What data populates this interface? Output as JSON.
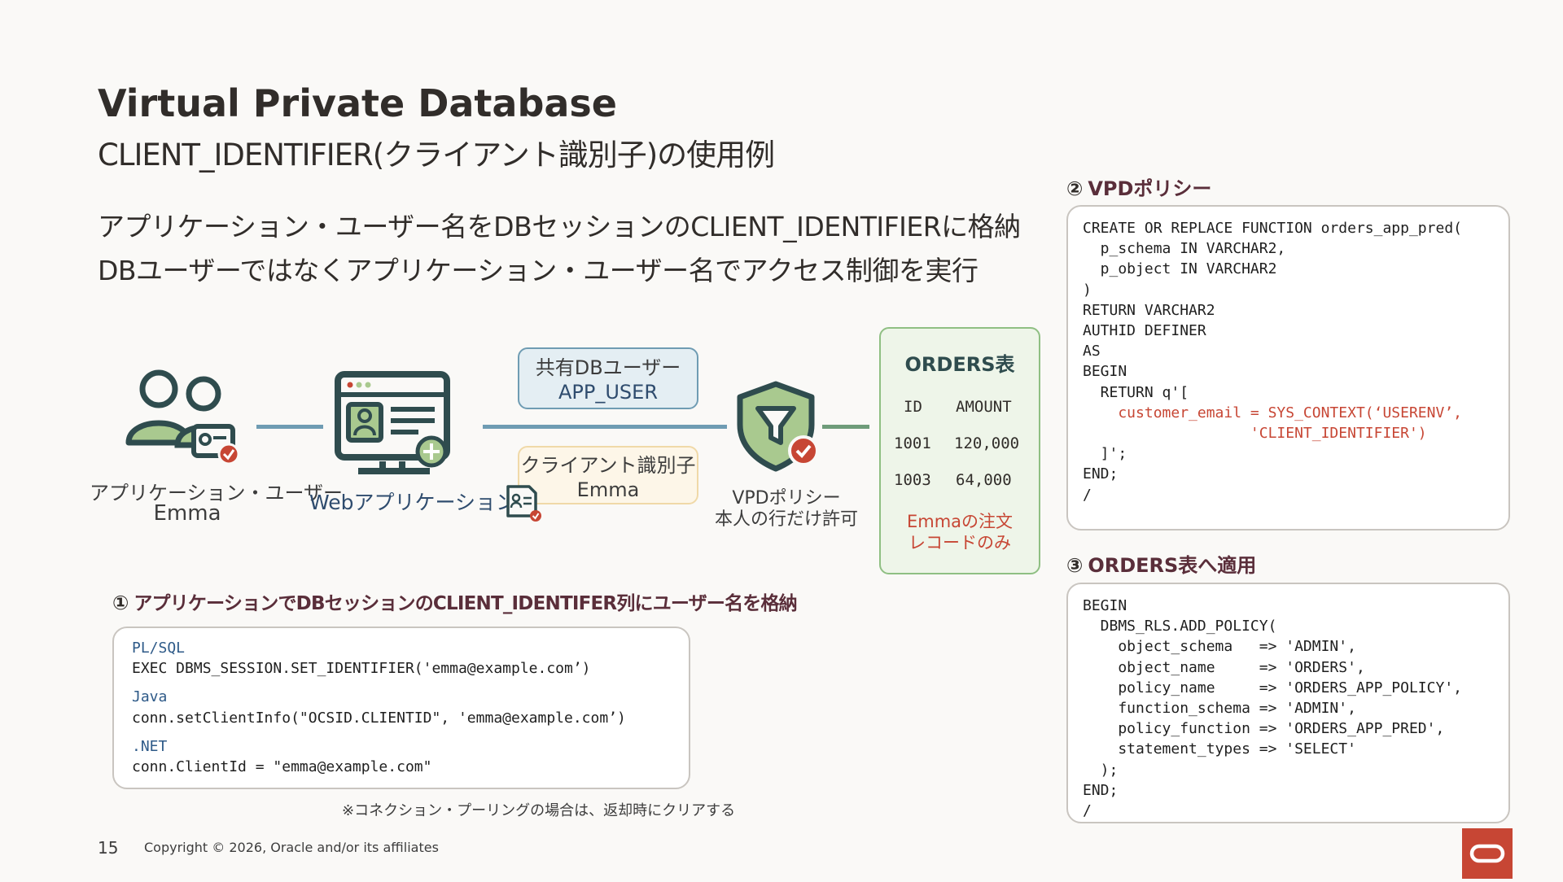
{
  "header": {
    "title": "Virtual Private Database",
    "subtitle": "CLIENT_IDENTIFIER(クライアント識別子)の使用例"
  },
  "bullets": [
    "アプリケーション・ユーザー名をDBセッションのCLIENT_IDENTIFIERに格納",
    "DBユーザーではなくアプリケーション・ユーザー名でアクセス制御を実行"
  ],
  "diagram": {
    "app_user": {
      "line1": "アプリケーション・ユーザー",
      "line2": "Emma"
    },
    "web_app": {
      "label": "Webアプリケーション"
    },
    "shared_db_user": {
      "line1": "共有DBユーザー",
      "line2": "APP_USER"
    },
    "client_identifier": {
      "line1": "クライアント識別子",
      "line2": "Emma"
    },
    "vpd_policy": {
      "line1": "VPDポリシー",
      "line2": "本人の行だけ許可"
    },
    "orders_table": {
      "title": "ORDERS表",
      "columns": [
        "ID",
        "AMOUNT"
      ],
      "rows": [
        [
          "1001",
          "120,000"
        ],
        [
          "1003",
          "64,000"
        ]
      ],
      "note_line1": "Emmaの注文",
      "note_line2": "レコードのみ"
    }
  },
  "section1": {
    "number": "①",
    "title": "アプリケーションでDBセッションのCLIENT_IDENTIFER列にユーザー名を格納",
    "plsql_label": "PL/SQL",
    "plsql_code": "EXEC DBMS_SESSION.SET_IDENTIFIER('emma@example.com’)",
    "java_label": "Java",
    "java_code": "conn.setClientInfo(\"OCSID.CLIENTID\", 'emma@example.com’)",
    "net_label": ".NET",
    "net_code": "conn.ClientId = \"emma@example.com\"",
    "note": "※コネクション・プーリングの場合は、返却時にクリアする"
  },
  "section2": {
    "number": "②",
    "title": "VPDポリシー",
    "code_before": "CREATE OR REPLACE FUNCTION orders_app_pred(\n  p_schema IN VARCHAR2,\n  p_object IN VARCHAR2\n)\nRETURN VARCHAR2\nAUTHID DEFINER\nAS\nBEGIN\n  RETURN q'[",
    "code_highlight": "    customer_email = SYS_CONTEXT(‘USERENV’,\n                   'CLIENT_IDENTIFIER')",
    "code_after": "  ]';\nEND;\n/"
  },
  "section3": {
    "number": "③",
    "title": "ORDERS表へ適用",
    "code": "BEGIN\n  DBMS_RLS.ADD_POLICY(\n    object_schema   => 'ADMIN',\n    object_name     => 'ORDERS',\n    policy_name     => 'ORDERS_APP_POLICY',\n    function_schema => 'ADMIN',\n    policy_function => 'ORDERS_APP_PRED',\n    statement_types => 'SELECT'\n  );\nEND;\n/"
  },
  "footer": {
    "page_number": "15",
    "copyright": "Copyright © 2026, Oracle and/or its affiliates"
  },
  "colors": {
    "oracle_red": "#c74634",
    "teal_dark": "#2f4c4e",
    "green_light": "#a9c98f",
    "line_blue": "#6f9cb3"
  }
}
